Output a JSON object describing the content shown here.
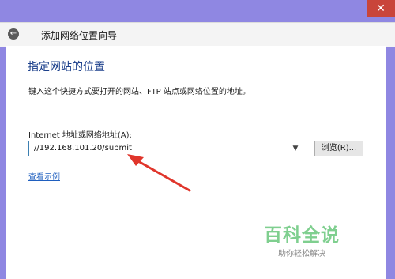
{
  "window": {
    "close_glyph": "✕",
    "title": "添加网络位置向导"
  },
  "page": {
    "heading": "指定网站的位置",
    "description": "键入这个快捷方式要打开的网站、FTP 站点或网络位置的地址。",
    "address_label": "Internet 地址或网络地址(A):",
    "address_value": "//192.168.101.20/submit",
    "browse_label": "浏览(R)...",
    "example_link": "查看示例"
  },
  "watermark": {
    "main": "百科全说",
    "sub": "助你轻松解决"
  },
  "colors": {
    "titlebar": "#8f87e2",
    "close": "#c9453a",
    "arrow": "#e0352b",
    "link": "#1f5fbf",
    "heading": "#1b3f8b"
  }
}
